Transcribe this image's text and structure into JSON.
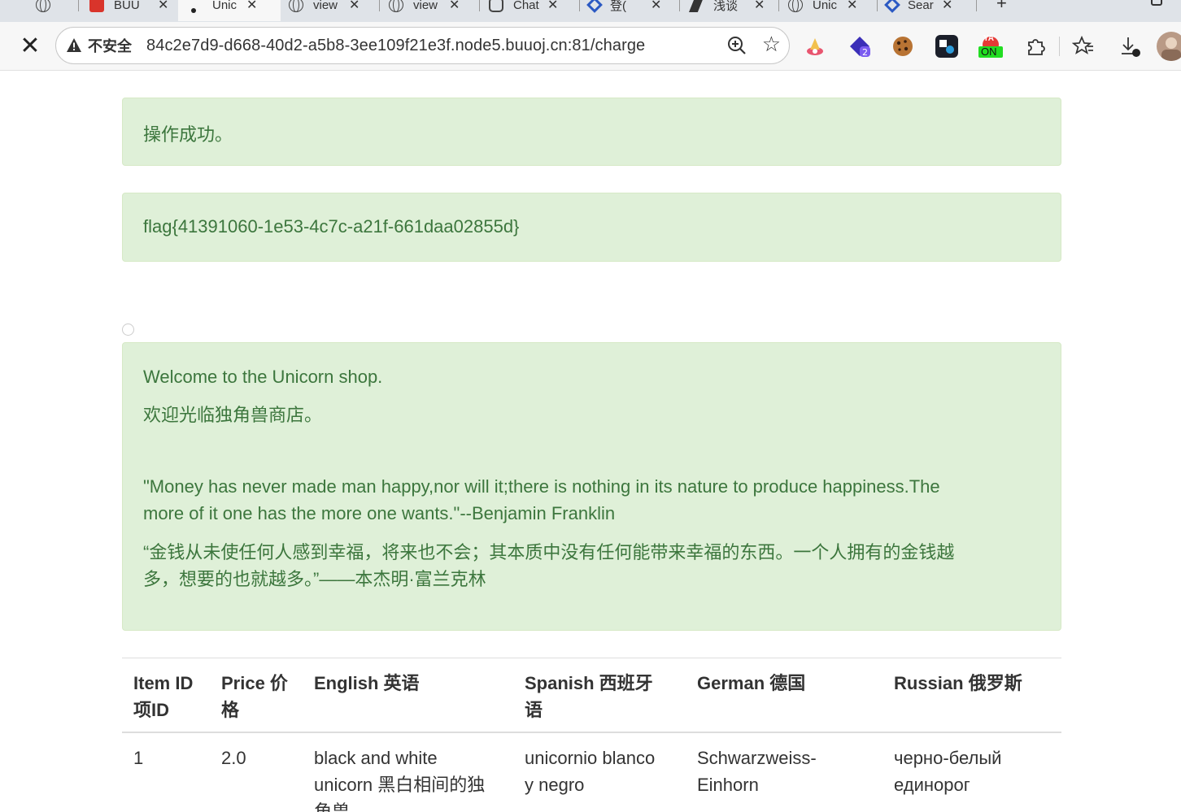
{
  "browser": {
    "tabs": [
      {
        "label": "BUU",
        "icon": "buu-logo-icon"
      },
      {
        "label": "Unic",
        "icon": "loading-dot-icon",
        "active": true
      },
      {
        "label": "view",
        "icon": "globe-icon"
      },
      {
        "label": "view",
        "icon": "globe-icon"
      },
      {
        "label": "Chat",
        "icon": "chatgpt-icon"
      },
      {
        "label": "登(",
        "icon": "translate-icon"
      },
      {
        "label": "浅谈",
        "icon": "article-icon"
      },
      {
        "label": "Unic",
        "icon": "globe-icon"
      },
      {
        "label": "Sear",
        "icon": "search-site-icon"
      }
    ],
    "new_tab": "+",
    "security_label": "不安全",
    "url": "84c2e7d9-d668-40d2-a5b8-3ee109f21e3f.node5.buuoj.cn:81/charge",
    "extensions": [
      "hat-extension-icon",
      "tampermonkey-extension-icon",
      "cookie-extension-icon",
      "translate-extension-icon",
      "on-badge-extension-icon",
      "puzzle-extensions-icon"
    ],
    "on_badge_text": "ON",
    "on_badge_top_text": "YA"
  },
  "page": {
    "success_message": "操作成功。",
    "flag": "flag{41391060-1e53-4c7c-a21f-661daa02855d}",
    "welcome_en": "Welcome to the Unicorn shop.",
    "welcome_zh": "欢迎光临独角兽商店。",
    "quote_en_1": "\"Money has never made man happy,nor will it;there is nothing in its nature to produce happiness.The",
    "quote_en_2": "more of it one has the more one wants.\"--Benjamin Franklin",
    "quote_zh_1": "“金钱从未使任何人感到幸福，将来也不会；其本质中没有任何能带来幸福的东西。一个人拥有的金钱越",
    "quote_zh_2": "多，想要的也就越多。”——本杰明·富兰克林"
  },
  "table": {
    "headers": [
      [
        "Item ID",
        "项ID"
      ],
      [
        "Price 价",
        "格"
      ],
      [
        "English 英语"
      ],
      [
        "Spanish 西班牙",
        "语"
      ],
      [
        "German 德国"
      ],
      [
        "Russian 俄罗斯"
      ]
    ],
    "rows": [
      {
        "id": "1",
        "price": "2.0",
        "english": [
          "black and white",
          "unicorn 黑白相间的独",
          "角兽"
        ],
        "spanish": [
          "unicornio blanco",
          "y negro"
        ],
        "german": [
          "Schwarzweiss-",
          "Einhorn"
        ],
        "russian": [
          "черно-белый",
          "единорог"
        ]
      }
    ]
  }
}
